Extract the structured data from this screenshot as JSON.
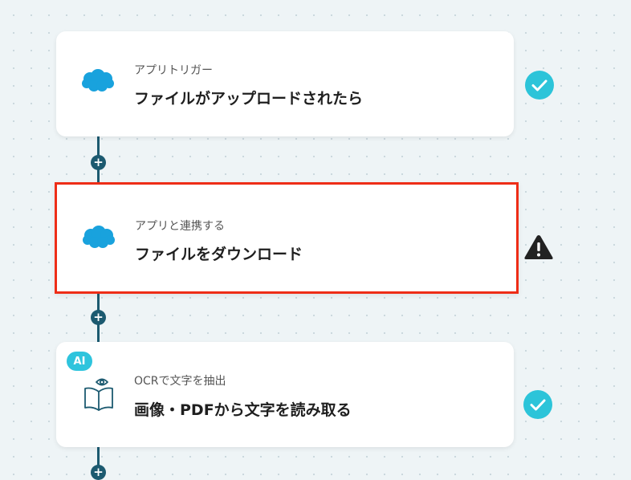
{
  "flow": {
    "steps": [
      {
        "subtitle": "アプリトリガー",
        "title": "ファイルがアップロードされたら",
        "icon": "salesforce-cloud-icon",
        "status": "check-circle-icon"
      },
      {
        "subtitle": "アプリと連携する",
        "title": "ファイルをダウンロード",
        "icon": "salesforce-cloud-icon",
        "status": "warning-triangle-icon"
      },
      {
        "subtitle": "OCRで文字を抽出",
        "title": "画像・PDFから文字を読み取る",
        "icon": "open-book-eye-icon",
        "status": "check-circle-icon",
        "badge": "AI"
      }
    ],
    "add_step_label": "+"
  },
  "colors": {
    "connector": "#1c5a70",
    "check": "#2cc4d9",
    "selected_border": "#ee2d17",
    "salesforce": "#19a2dd",
    "ai_badge": "#2ec4dd"
  }
}
